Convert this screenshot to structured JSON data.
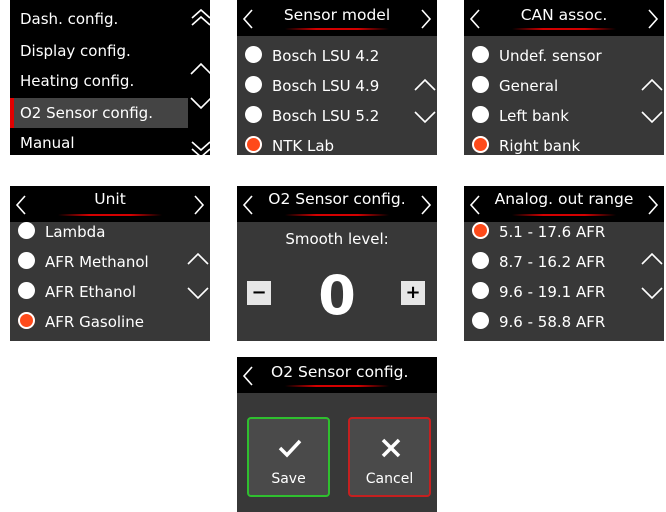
{
  "panel1": {
    "items": [
      "Dash. config.",
      "Display config.",
      "Heating config.",
      "O2 Sensor config.",
      "Manual"
    ],
    "selected_index": 3
  },
  "panel2": {
    "title": "Sensor model",
    "options": [
      "Bosch LSU 4.2",
      "Bosch LSU 4.9",
      "Bosch LSU 5.2",
      "NTK Lab"
    ],
    "selected_index": 3
  },
  "panel3": {
    "title": "CAN assoc.",
    "options": [
      "Undef. sensor",
      "General",
      "Left bank",
      "Right bank"
    ],
    "selected_index": 3
  },
  "panel4": {
    "title": "Unit",
    "options": [
      "Lambda",
      "AFR Methanol",
      "AFR Ethanol",
      "AFR Gasoline"
    ],
    "selected_index": 3
  },
  "panel5": {
    "title": "O2 Sensor config.",
    "subtitle": "Smooth level:",
    "value": "0",
    "minus_label": "−",
    "plus_label": "+"
  },
  "panel6": {
    "title": "Analog. out range",
    "options": [
      "5.1 - 17.6 AFR",
      "8.7 - 16.2 AFR",
      "9.6 - 19.1 AFR",
      "9.6 - 58.8 AFR"
    ],
    "selected_index": 0
  },
  "panel7": {
    "title": "O2 Sensor config.",
    "save_label": "Save",
    "cancel_label": "Cancel"
  },
  "colors": {
    "accent_red": "#d40000",
    "radio_selected": "#ff4a1a",
    "save_border": "#2fbf2f",
    "cancel_border": "#c52020",
    "panel_gray": "#383838"
  },
  "icons": [
    "chevron-left-icon",
    "chevron-right-icon",
    "chevron-up-icon",
    "chevron-down-icon",
    "double-chevron-up-icon",
    "double-chevron-down-icon",
    "check-icon",
    "x-icon"
  ]
}
